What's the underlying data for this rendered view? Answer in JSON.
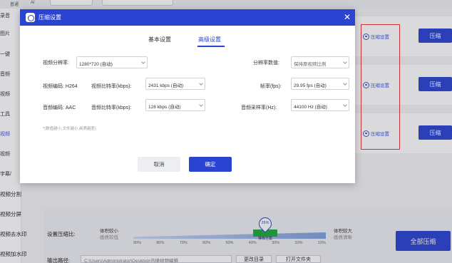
{
  "top_bar": {
    "tabs": [
      "普通",
      "AI"
    ]
  },
  "sidebar": {
    "items": [
      "录音",
      "图片",
      "一键",
      "音频",
      "视频",
      "工具",
      "视频",
      "视频",
      "字幕/"
    ],
    "wide_items": [
      "视频分割",
      "视频分屏",
      "视频去水印",
      "视频加水印"
    ]
  },
  "rows": [
    {
      "link": "压缩设置",
      "button": "压缩"
    },
    {
      "link": "压缩设置",
      "button": "压缩"
    },
    {
      "link": "压缩设置",
      "button": "压缩"
    }
  ],
  "bottom": {
    "ratio_label": "设置压缩比:",
    "left_label": "体积较小",
    "left_sub": "画质较低",
    "right_label": "体积较大",
    "right_sub": "画质清晰",
    "thumb_value": "25%",
    "recommend": "推荐方案",
    "ticks": [
      "90%",
      "80%",
      "70%",
      "60%",
      "50%",
      "40%",
      "30%",
      "20%",
      "10%"
    ],
    "output_label": "输出路径:",
    "output_path": "C:\\Users\\Administrator\\Desktop\\迅捷视频编辑",
    "change_dir": "更改目录",
    "open_folder": "打开文件夹",
    "all_zip": "全部压缩"
  },
  "dialog": {
    "title": "压缩设置",
    "tabs": [
      "基本设置",
      "高级设置"
    ],
    "active_tab": 1,
    "fields": {
      "resolution_label": "视频分辨率:",
      "resolution_value": "1280*720 (自动)",
      "res_value_label": "分辨率数值:",
      "res_value_value": "保持原视频比例",
      "vcodec": "视频编码: H264",
      "vbitrate_label": "视频比特率(kbps):",
      "vbitrate_value": "2431 kbps (自动)",
      "fps_label": "帧率(fps):",
      "fps_value": "29.95 fps (自动)",
      "acodec": "音频编码: AAC",
      "abitrate_label": "音频比特率(kbps):",
      "abitrate_value": "128 kbps (自动)",
      "samplerate_label": "音频采样率(Hz):",
      "samplerate_value": "44100 Hz (自动)"
    },
    "hint": "*(数值越小,文件越小,画质越差)",
    "cancel": "取消",
    "ok": "确定"
  },
  "colors": {
    "accent": "#2a44d1",
    "annotation": "#e8363a",
    "recommend": "#1daa3a"
  }
}
